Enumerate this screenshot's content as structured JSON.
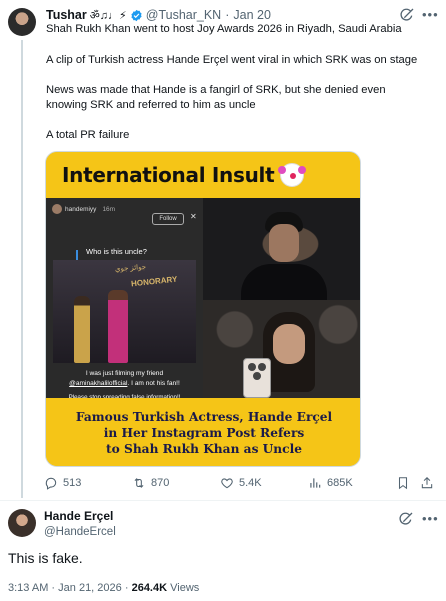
{
  "parent_tweet": {
    "author_name": "Tushar",
    "author_decoration": "ॐ♫♩⚡",
    "author_handle": "@Tushar_KN",
    "date_separator": "·",
    "date": "Jan 20",
    "paragraphs": [
      "Shah Rukh Khan went to host Joy Awards 2026 in Riyadh, Saudi Arabia",
      "A clip of Turkish actress Hande Erçel went viral in which SRK was on stage",
      "News was made that Hande is a fangirl of SRK, but she denied even knowing SRK and referred to him as uncle",
      "A total PR failure"
    ],
    "image": {
      "banner_title": "International Insult",
      "story_username": "handemiyy",
      "story_time": "16m",
      "story_follow": "Follow",
      "story_question": "Who is this uncle?",
      "story_sign_top": "HONORARY",
      "story_caption_1": "I was just filming  my friend",
      "story_caption_link": "@aminakhalilofficial",
      "story_caption_2": ". I am not his fan!!",
      "story_caption_3": "Please stop spreading false information!!",
      "bottom_lines": [
        "Famous Turkish Actress, Hande Erçel",
        "in Her Instagram Post Refers",
        "to Shah Rukh Khan as Uncle"
      ]
    },
    "actions": {
      "replies": "513",
      "reposts": "870",
      "likes": "5.4K",
      "views": "685K"
    }
  },
  "reply_tweet": {
    "author_name": "Hande Erçel",
    "author_handle": "@HandeErcel",
    "text": "This is fake.",
    "time": "3:13 AM",
    "date_separator": "·",
    "date": "Jan 21, 2026",
    "views_separator": "·",
    "views_count": "264.4K",
    "views_label": "Views"
  },
  "colors": {
    "text": "#0f1419",
    "secondary": "#536471",
    "verified": "#1d9bf0",
    "banner": "#f5c517"
  },
  "icons": [
    "verified-badge-icon",
    "grok-icon",
    "more-icon",
    "reply-icon",
    "repost-icon",
    "like-icon",
    "views-icon",
    "bookmark-icon",
    "share-icon"
  ]
}
